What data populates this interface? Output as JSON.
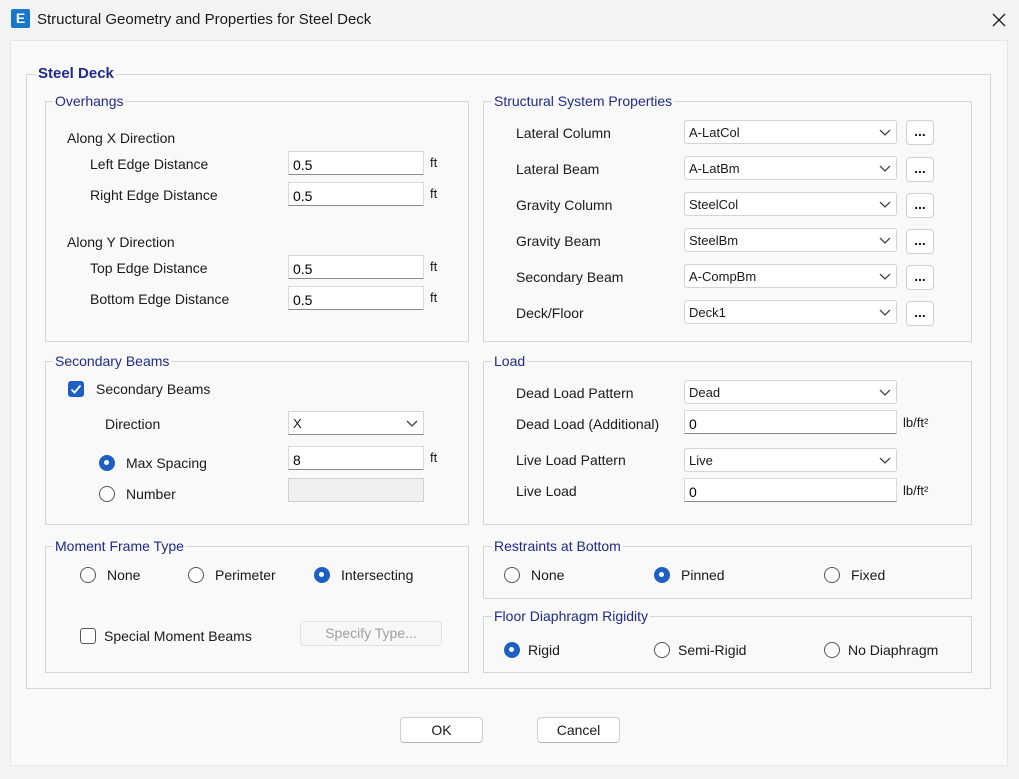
{
  "window": {
    "app_icon_letter": "E",
    "title": "Structural Geometry and Properties for Steel Deck",
    "close_glyph": "×"
  },
  "main_group": {
    "title": "Steel Deck"
  },
  "overhangs": {
    "title": "Overhangs",
    "x_heading": "Along X Direction",
    "y_heading": "Along Y Direction",
    "unit": "ft",
    "fields": [
      {
        "label": "Left Edge Distance",
        "value": "0.5"
      },
      {
        "label": "Right Edge Distance",
        "value": "0.5"
      },
      {
        "label": "Top Edge Distance",
        "value": "0.5"
      },
      {
        "label": "Bottom Edge Distance",
        "value": "0.5"
      }
    ]
  },
  "structural_system": {
    "title": "Structural System Properties",
    "button_label": "...",
    "rows": [
      {
        "label": "Lateral Column",
        "value": "A-LatCol"
      },
      {
        "label": "Lateral Beam",
        "value": "A-LatBm"
      },
      {
        "label": "Gravity Column",
        "value": "SteelCol"
      },
      {
        "label": "Gravity Beam",
        "value": "SteelBm"
      },
      {
        "label": "Secondary Beam",
        "value": "A-CompBm"
      },
      {
        "label": "Deck/Floor",
        "value": "Deck1"
      }
    ]
  },
  "secondary_beams": {
    "title": "Secondary Beams",
    "checkbox_label": "Secondary Beams",
    "checked": true,
    "direction_label": "Direction",
    "direction_value": "X",
    "max_spacing_label": "Max Spacing",
    "max_spacing_value": "8",
    "max_spacing_unit": "ft",
    "number_label": "Number",
    "number_value": "",
    "selected_option": "Max Spacing"
  },
  "load": {
    "title": "Load",
    "dead_pattern_label": "Dead Load Pattern",
    "dead_pattern_value": "Dead",
    "dead_additional_label": "Dead Load (Additional)",
    "dead_additional_value": "0",
    "live_pattern_label": "Live Load Pattern",
    "live_pattern_value": "Live",
    "live_load_label": "Live Load",
    "live_load_value": "0",
    "unit": "lb/ft²"
  },
  "moment_frame": {
    "title": "Moment Frame Type",
    "options": [
      "None",
      "Perimeter",
      "Intersecting"
    ],
    "selected": "Intersecting",
    "special_label": "Special Moment Beams",
    "special_checked": false,
    "specify_button": "Specify Type..."
  },
  "restraints": {
    "title": "Restraints at Bottom",
    "options": [
      "None",
      "Pinned",
      "Fixed"
    ],
    "selected": "Pinned"
  },
  "diaphragm": {
    "title": "Floor Diaphragm Rigidity",
    "options": [
      "Rigid",
      "Semi-Rigid",
      "No Diaphragm"
    ],
    "selected": "Rigid"
  },
  "buttons": {
    "ok": "OK",
    "cancel": "Cancel"
  },
  "colors": {
    "accent": "#1d5fc2",
    "group_title": "#1f2a8c",
    "app_icon": "#1877c9"
  }
}
